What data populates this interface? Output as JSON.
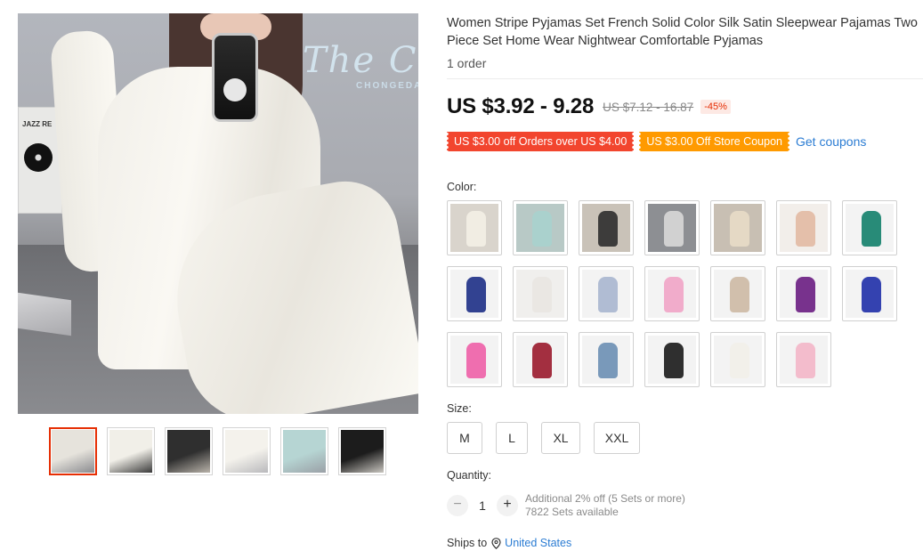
{
  "gallery": {
    "main_image_alt": "Main product image",
    "wall_sign_text": "The Cl",
    "wall_sign_sub": "CHONGEDA",
    "poster_text": "JAZZ RE",
    "thumbnails": [
      {
        "icon": "thumb-white-striped-selfie",
        "colors": [
          "#e6e3dc",
          "#8a8b8f"
        ]
      },
      {
        "icon": "thumb-white-standing",
        "colors": [
          "#f1efe8",
          "#3a3a3a"
        ]
      },
      {
        "icon": "thumb-black-bed",
        "colors": [
          "#2f2f2f",
          "#b9b3aa"
        ]
      },
      {
        "icon": "thumb-white-sitting",
        "colors": [
          "#f4f2ec",
          "#b9b9bc"
        ]
      },
      {
        "icon": "thumb-mint",
        "colors": [
          "#b6d5d3",
          "#9aa0a6"
        ]
      },
      {
        "icon": "thumb-black-grey-stripe",
        "colors": [
          "#1c1c1c",
          "#c9c6c0"
        ]
      }
    ]
  },
  "product": {
    "title": "Women Stripe Pyjamas Set French Solid Color Silk Satin Sleepwear Pajamas Two Piece Set Home Wear Nightwear Comfortable Pyjamas",
    "orders": "1 order",
    "price": "US $3.92 - 9.28",
    "original_price": "US $7.12 - 16.87",
    "discount": "-45%",
    "coupons": [
      {
        "text": "US $3.00 off Orders over US $4.00",
        "color": "#f2452e"
      },
      {
        "text": "US $3.00 Off Store Coupon",
        "color": "#ff9a00"
      }
    ],
    "get_coupons": "Get coupons"
  },
  "color": {
    "label": "Color:",
    "swatches": [
      {
        "name": "white-stripe",
        "bg": "#d9d4cc",
        "fg": "#f3efe6"
      },
      {
        "name": "mint",
        "bg": "#b8c9c6",
        "fg": "#a9d2cd"
      },
      {
        "name": "black",
        "bg": "#c9c2b8",
        "fg": "#2d2d2d"
      },
      {
        "name": "grey-stripe",
        "bg": "#8d8f93",
        "fg": "#d8d8d8"
      },
      {
        "name": "champagne",
        "bg": "#c8bfb3",
        "fg": "#e8dcc6"
      },
      {
        "name": "nude-pink",
        "bg": "#f2eeea",
        "fg": "#e2b9a3"
      },
      {
        "name": "emerald",
        "bg": "#f3f3f3",
        "fg": "#12806a"
      },
      {
        "name": "navy",
        "bg": "#f3f3f3",
        "fg": "#1d2f86"
      },
      {
        "name": "white",
        "bg": "#f0efed",
        "fg": "#e9e6e1"
      },
      {
        "name": "light-blue-grey",
        "bg": "#f3f3f3",
        "fg": "#a9b6cf"
      },
      {
        "name": "pink",
        "bg": "#f3f3f3",
        "fg": "#f1a4c7"
      },
      {
        "name": "beige",
        "bg": "#f3f3f3",
        "fg": "#cdb9a4"
      },
      {
        "name": "purple",
        "bg": "#f3f3f3",
        "fg": "#6a1d82"
      },
      {
        "name": "royal-blue",
        "bg": "#f3f3f3",
        "fg": "#1f2fa8"
      },
      {
        "name": "hot-pink",
        "bg": "#f3f3f3",
        "fg": "#ee5fa7"
      },
      {
        "name": "wine-red",
        "bg": "#f3f3f3",
        "fg": "#9a1a2c"
      },
      {
        "name": "denim-blue",
        "bg": "#f3f3f3",
        "fg": "#6b8fb4"
      },
      {
        "name": "black-cami",
        "bg": "#f3f3f3",
        "fg": "#1a1a1a"
      },
      {
        "name": "white-cami",
        "bg": "#f3f3f3",
        "fg": "#f2efe9"
      },
      {
        "name": "pink-cami",
        "bg": "#f3f3f3",
        "fg": "#f3b6c8"
      }
    ]
  },
  "size": {
    "label": "Size:",
    "options": [
      "M",
      "L",
      "XL",
      "XXL"
    ]
  },
  "quantity": {
    "label": "Quantity:",
    "minus": "−",
    "value": "1",
    "plus": "+",
    "note_line1": "Additional 2% off (5 Sets or more)",
    "note_line2": "7822 Sets available"
  },
  "shipping": {
    "label": "Ships to",
    "country": "United States"
  }
}
